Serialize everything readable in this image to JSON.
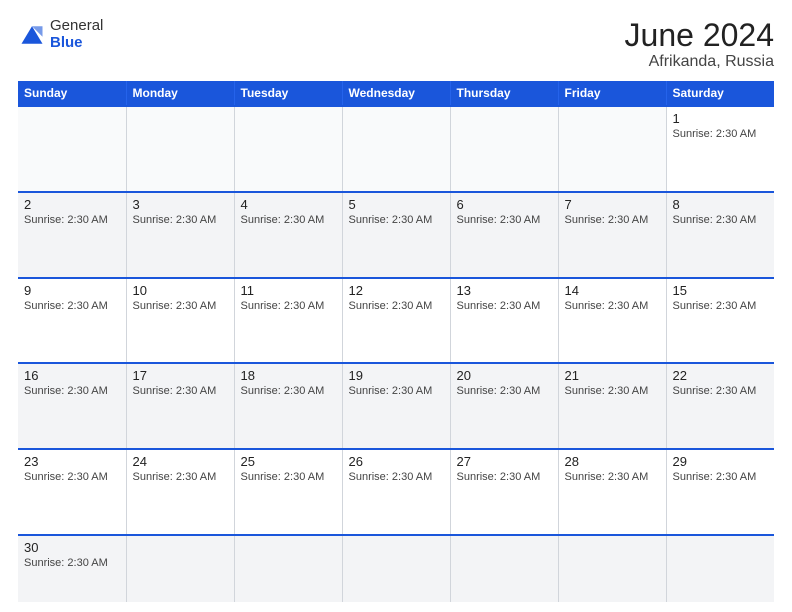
{
  "header": {
    "logo": {
      "general": "General",
      "blue": "Blue"
    },
    "month": "June 2024",
    "location": "Afrikanda, Russia"
  },
  "days_of_week": [
    "Sunday",
    "Monday",
    "Tuesday",
    "Wednesday",
    "Thursday",
    "Friday",
    "Saturday"
  ],
  "rows": [
    [
      {
        "day": "",
        "sunrise": "",
        "empty": true
      },
      {
        "day": "",
        "sunrise": "",
        "empty": true
      },
      {
        "day": "",
        "sunrise": "",
        "empty": true
      },
      {
        "day": "",
        "sunrise": "",
        "empty": true
      },
      {
        "day": "",
        "sunrise": "",
        "empty": true
      },
      {
        "day": "",
        "sunrise": "",
        "empty": true
      },
      {
        "day": "1",
        "sunrise": "Sunrise: 2:30 AM",
        "empty": false
      }
    ],
    [
      {
        "day": "2",
        "sunrise": "Sunrise: 2:30 AM",
        "empty": false
      },
      {
        "day": "3",
        "sunrise": "Sunrise: 2:30 AM",
        "empty": false
      },
      {
        "day": "4",
        "sunrise": "Sunrise: 2:30 AM",
        "empty": false
      },
      {
        "day": "5",
        "sunrise": "Sunrise: 2:30 AM",
        "empty": false
      },
      {
        "day": "6",
        "sunrise": "Sunrise: 2:30 AM",
        "empty": false
      },
      {
        "day": "7",
        "sunrise": "Sunrise: 2:30 AM",
        "empty": false
      },
      {
        "day": "8",
        "sunrise": "Sunrise: 2:30 AM",
        "empty": false
      }
    ],
    [
      {
        "day": "9",
        "sunrise": "Sunrise: 2:30 AM",
        "empty": false
      },
      {
        "day": "10",
        "sunrise": "Sunrise: 2:30 AM",
        "empty": false
      },
      {
        "day": "11",
        "sunrise": "Sunrise: 2:30 AM",
        "empty": false
      },
      {
        "day": "12",
        "sunrise": "Sunrise: 2:30 AM",
        "empty": false
      },
      {
        "day": "13",
        "sunrise": "Sunrise: 2:30 AM",
        "empty": false
      },
      {
        "day": "14",
        "sunrise": "Sunrise: 2:30 AM",
        "empty": false
      },
      {
        "day": "15",
        "sunrise": "Sunrise: 2:30 AM",
        "empty": false
      }
    ],
    [
      {
        "day": "16",
        "sunrise": "Sunrise: 2:30 AM",
        "empty": false
      },
      {
        "day": "17",
        "sunrise": "Sunrise: 2:30 AM",
        "empty": false
      },
      {
        "day": "18",
        "sunrise": "Sunrise: 2:30 AM",
        "empty": false
      },
      {
        "day": "19",
        "sunrise": "Sunrise: 2:30 AM",
        "empty": false
      },
      {
        "day": "20",
        "sunrise": "Sunrise: 2:30 AM",
        "empty": false
      },
      {
        "day": "21",
        "sunrise": "Sunrise: 2:30 AM",
        "empty": false
      },
      {
        "day": "22",
        "sunrise": "Sunrise: 2:30 AM",
        "empty": false
      }
    ],
    [
      {
        "day": "23",
        "sunrise": "Sunrise: 2:30 AM",
        "empty": false
      },
      {
        "day": "24",
        "sunrise": "Sunrise: 2:30 AM",
        "empty": false
      },
      {
        "day": "25",
        "sunrise": "Sunrise: 2:30 AM",
        "empty": false
      },
      {
        "day": "26",
        "sunrise": "Sunrise: 2:30 AM",
        "empty": false
      },
      {
        "day": "27",
        "sunrise": "Sunrise: 2:30 AM",
        "empty": false
      },
      {
        "day": "28",
        "sunrise": "Sunrise: 2:30 AM",
        "empty": false
      },
      {
        "day": "29",
        "sunrise": "Sunrise: 2:30 AM",
        "empty": false
      }
    ],
    [
      {
        "day": "30",
        "sunrise": "Sunrise: 2:30 AM",
        "empty": false
      },
      {
        "day": "",
        "sunrise": "",
        "empty": true
      },
      {
        "day": "",
        "sunrise": "",
        "empty": true
      },
      {
        "day": "",
        "sunrise": "",
        "empty": true
      },
      {
        "day": "",
        "sunrise": "",
        "empty": true
      },
      {
        "day": "",
        "sunrise": "",
        "empty": true
      },
      {
        "day": "",
        "sunrise": "",
        "empty": true
      }
    ]
  ],
  "row_classes": [
    "row-odd",
    "row-even",
    "row-odd",
    "row-even",
    "row-odd",
    "row-even"
  ]
}
